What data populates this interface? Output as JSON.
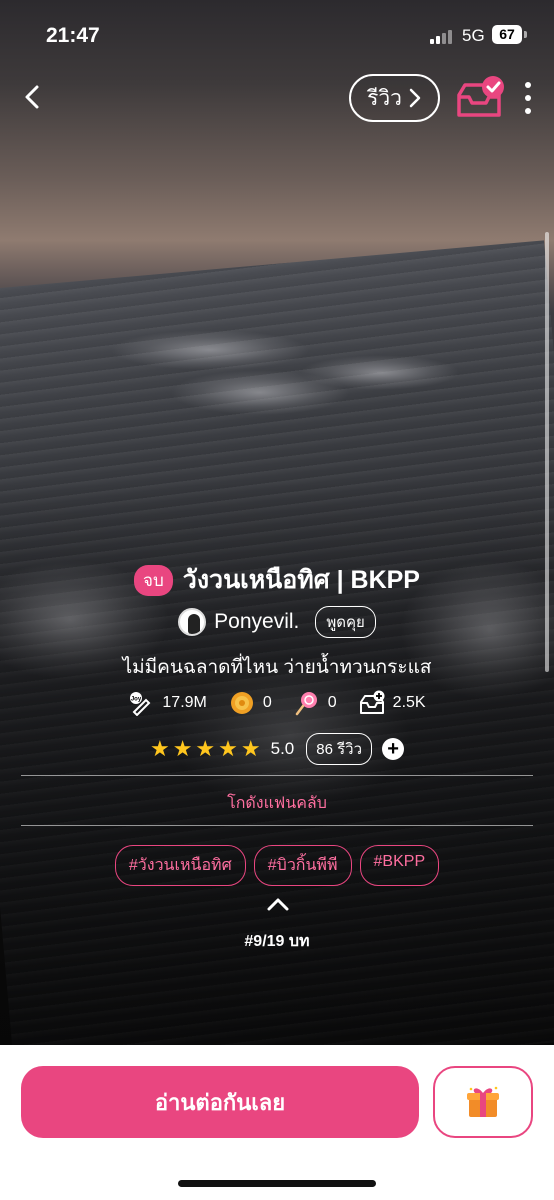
{
  "status_bar": {
    "time": "21:47",
    "network": "5G",
    "battery": "67"
  },
  "header": {
    "review_label": "รีวิว",
    "back_icon": "chevron-left-icon",
    "shelf_icon": "bookshelf-check-icon",
    "more_icon": "more-vertical-icon"
  },
  "novel": {
    "status_badge": "จบ",
    "title": "วังวนเหนือทิศ | BKPP",
    "author": "Ponyevil.",
    "chat_label": "พูดคุย",
    "tagline": "ไม่มีคนฉลาดที่ไหน ว่ายน้ำทวนกระแส"
  },
  "stats": {
    "views": "17.9M",
    "coins": "0",
    "candies": "0",
    "shelf_adds": "2.5K"
  },
  "rating": {
    "stars": 5,
    "value": "5.0",
    "reviews": "86 รีวิว"
  },
  "fanclub_label": "โกดังแฟนคลับ",
  "tags": [
    "#วังวนเหนือทิศ",
    "#บิวกิ้นพีพี",
    "#BKPP"
  ],
  "episode": "#9/19 บท",
  "footer": {
    "read_label": "อ่านต่อกันเลย",
    "gift_icon": "gift-icon"
  },
  "colors": {
    "accent": "#e94680",
    "accent_text": "#ff6fa0",
    "star": "#ffc61e"
  }
}
